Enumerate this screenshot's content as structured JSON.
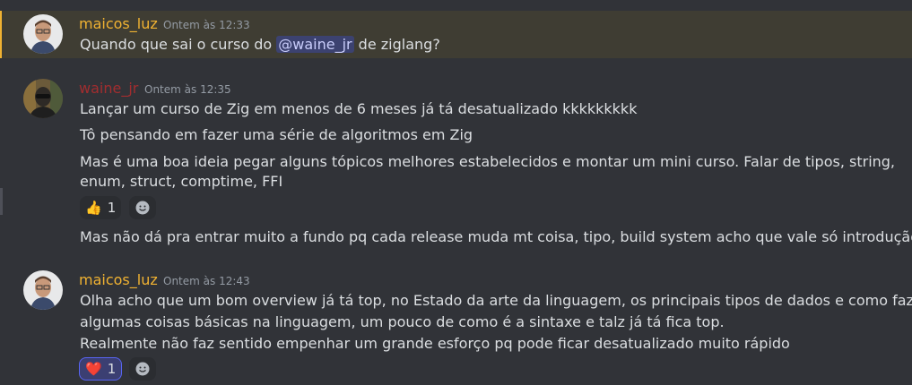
{
  "messages": [
    {
      "author": "maicos_luz",
      "author_color": "#f0b232",
      "time": "Ontem às 12:33",
      "text_before": "Quando que sai o curso do ",
      "mention": "@waine_jr",
      "text_after": " de ziglang?"
    },
    {
      "author": "waine_jr",
      "author_color": "#a12d2f",
      "time": "Ontem às 12:35",
      "lines": [
        "Lançar um curso de Zig em menos de 6 meses já tá desatualizado kkkkkkkkk",
        "Tô pensando em fazer uma série de algoritmos em Zig",
        "Mas é uma boa ideia pegar alguns tópicos melhores estabelecidos e montar um mini curso. Falar de tipos, string,",
        "enum, struct, comptime, FFI"
      ],
      "reaction": {
        "emoji": "👍",
        "count": "1"
      },
      "followup": "Mas não dá pra entrar muito a fundo pq cada release muda mt coisa, tipo, build system acho que vale só introdução"
    },
    {
      "author": "maicos_luz",
      "author_color": "#f0b232",
      "time": "Ontem às 12:43",
      "lines": [
        "Olha acho que um bom overview já tá top, no Estado da arte da linguagem, os principais tipos de dados e como fazer",
        "algumas coisas básicas na linguagem, um pouco de como é a sintaxe e talz já tá fica top.",
        "Realmente não faz sentido empenhar um grande esforço pq pode ficar desatualizado muito rápido"
      ],
      "reaction": {
        "emoji": "❤️",
        "count": "1"
      }
    }
  ],
  "icons": {
    "add_reaction": "smiley-add-icon"
  }
}
